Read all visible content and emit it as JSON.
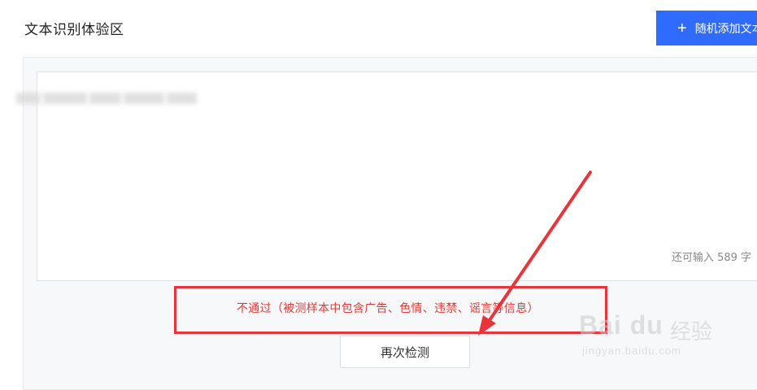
{
  "header": {
    "title": "文本识别体验区",
    "add_button_label": "随机添加文本",
    "add_button_icon": "plus-icon"
  },
  "editor": {
    "char_count_text": "还可输入 589 字"
  },
  "result": {
    "message": "不通过（被测样本中包含广告、色情、违禁、谣言等信息）",
    "color": "#e53935"
  },
  "actions": {
    "recheck_label": "再次检测"
  },
  "annotation": {
    "highlight_color": "#e8343a",
    "arrow_color": "#e8343a"
  },
  "watermark": {
    "brand": "Bai du",
    "jingyan": "经验",
    "url": "jingyan.baidu.com"
  },
  "colors": {
    "accent": "#2f6bff"
  }
}
